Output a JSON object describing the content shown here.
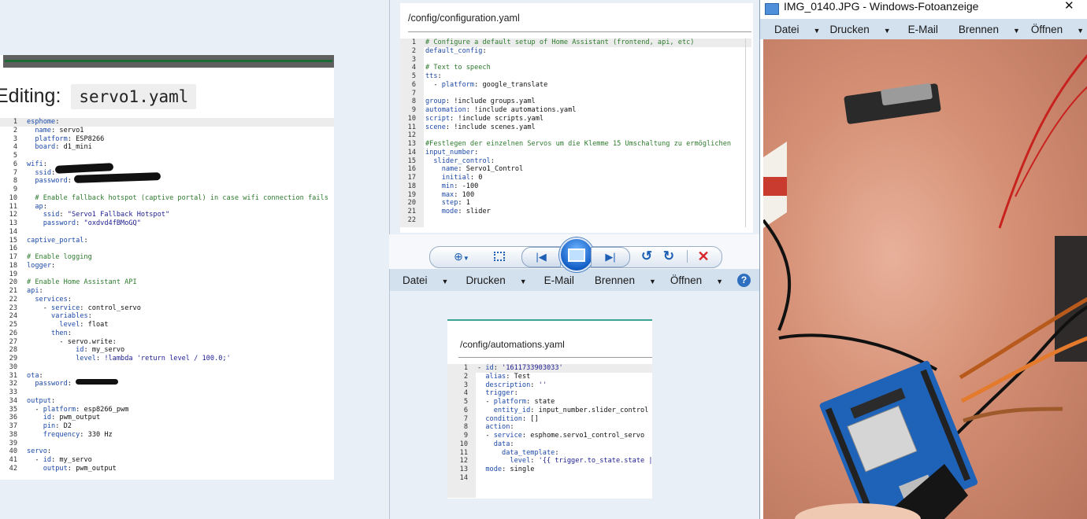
{
  "left_editor": {
    "title_prefix": "Editing:",
    "filename": "servo1.yaml",
    "lines": [
      "esphome:",
      "  name: servo1",
      "  platform: ESP8266",
      "  board: d1_mini",
      "",
      "wifi:",
      "  ssid: ",
      "  password: ",
      "",
      "  # Enable fallback hotspot (captive portal) in case wifi connection fails",
      "  ap:",
      "    ssid: \"Servo1 Fallback Hotspot\"",
      "    password: \"oxdvd4fBMoGQ\"",
      "",
      "captive_portal:",
      "",
      "# Enable logging",
      "logger:",
      "",
      "# Enable Home Assistant API",
      "api:",
      "  services:",
      "    - service: control_servo",
      "      variables:",
      "        level: float",
      "      then:",
      "        - servo.write:",
      "            id: my_servo",
      "            level: !lambda 'return level / 100.0;'",
      "",
      "ota:",
      "  password: ",
      "",
      "output:",
      "  - platform: esp8266_pwm",
      "    id: pwm_output",
      "    pin: D2",
      "    frequency: 330 Hz",
      "",
      "servo:",
      "  - id: my_servo",
      "    output: pwm_output"
    ]
  },
  "config_editor": {
    "path": "/config/configuration.yaml",
    "lines": [
      "# Configure a default setup of Home Assistant (frontend, api, etc)",
      "default_config:",
      "",
      "# Text to speech",
      "tts:",
      "  - platform: google_translate",
      "",
      "group: !include groups.yaml",
      "automation: !include automations.yaml",
      "script: !include scripts.yaml",
      "scene: !include scenes.yaml",
      "",
      "#Festlegen der einzelnen Servos um die Klemme 15 Umschaltung zu ermöglichen",
      "input_number:",
      "  slider_control:",
      "    name: Servo1_Control",
      "    initial: 0",
      "    min: -100",
      "    max: 100",
      "    step: 1",
      "    mode: slider",
      ""
    ]
  },
  "automations_editor": {
    "path": "/config/automations.yaml",
    "lines": [
      "- id: '1611733903033'",
      "  alias: Test",
      "  description: ''",
      "  trigger:",
      "  - platform: state",
      "    entity_id: input_number.slider_control",
      "  condition: []",
      "  action:",
      "  - service: esphome.servo1_control_servo",
      "    data:",
      "      data_template:",
      "        level: '{{ trigger.to_state.state |",
      "  mode: single",
      ""
    ]
  },
  "back_menu": {
    "items": [
      "Datei",
      "Drucken",
      "E-Mail",
      "Brennen",
      "Öffnen"
    ]
  },
  "photo_viewer": {
    "window_title": "IMG_0140.JPG - Windows-Fotoanzeige",
    "menu": [
      "Datei",
      "Drucken",
      "E-Mail",
      "Brennen",
      "Öffnen"
    ]
  },
  "toolbar": {
    "buttons": [
      "zoom-icon",
      "fit-icon",
      "previous-icon",
      "slideshow-icon",
      "next-icon",
      "rotate-left-icon",
      "rotate-right-icon",
      "delete-icon"
    ]
  },
  "colors": {
    "editor_green": "#1b6b36",
    "teal_border": "#3aa391",
    "gutter_bg": "#ececec",
    "windows_blue": "#2878d4"
  }
}
